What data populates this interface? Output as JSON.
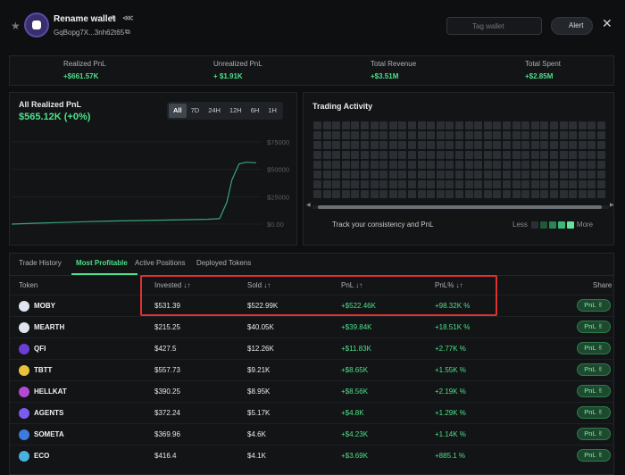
{
  "header": {
    "wallet_name": "Rename wallet",
    "address": "GqBopg7X...3nh62t65",
    "tag_placeholder": "Tag wallet",
    "alert_label": "Alert"
  },
  "stats": [
    {
      "label": "Realized PnL",
      "value": "+$661.57K"
    },
    {
      "label": "Unrealized PnL",
      "value": "+ $1.91K"
    },
    {
      "label": "Total Revenue",
      "value": "+$3.51M"
    },
    {
      "label": "Total Spent",
      "value": "+$2.85M"
    }
  ],
  "pnl_panel": {
    "title": "All Realized PnL",
    "value": "$565.12K (+0%)",
    "ranges": [
      "All",
      "7D",
      "24H",
      "12H",
      "6H",
      "1H"
    ],
    "active_range": "All",
    "yticks": [
      "$75000",
      "$50000",
      "$25000",
      "$0.00"
    ]
  },
  "chart_data": {
    "type": "line",
    "title": "",
    "xlabel": "",
    "ylabel": "",
    "ylim": [
      0,
      75000
    ],
    "x": [
      0,
      10,
      20,
      30,
      40,
      50,
      60,
      70,
      80,
      85,
      88,
      90,
      93,
      96,
      100
    ],
    "series": [
      {
        "values": [
          0,
          800,
          1500,
          2200,
          2800,
          3200,
          3600,
          4000,
          4400,
          5000,
          20000,
          40000,
          55000,
          56500,
          56000
        ]
      }
    ]
  },
  "activity": {
    "title": "Trading Activity",
    "subtitle": "Track your consistency and PnL",
    "legend_less": "Less",
    "legend_more": "More"
  },
  "tabs": [
    "Trade History",
    "Most Profitable",
    "Active Positions",
    "Deployed Tokens"
  ],
  "table": {
    "headers": {
      "token": "Token",
      "invested": "Invested",
      "sold": "Sold",
      "pnl": "PnL",
      "pnl_pct": "PnL%",
      "share": "Share"
    },
    "rows": [
      {
        "token": "MOBY",
        "invested": "$531.39",
        "sold": "$522.99K",
        "pnl": "+$522.46K",
        "pct": "+98.32K %",
        "color": "#dfe6f0"
      },
      {
        "token": "MEARTH",
        "invested": "$215.25",
        "sold": "$40.05K",
        "pnl": "+$39.84K",
        "pct": "+18.51K %",
        "color": "#e0e6ec"
      },
      {
        "token": "QFI",
        "invested": "$427.5",
        "sold": "$12.26K",
        "pnl": "+$11.83K",
        "pct": "+2.77K %",
        "color": "#6b3fd6"
      },
      {
        "token": "TBTT",
        "invested": "$557.73",
        "sold": "$9.21K",
        "pnl": "+$8.65K",
        "pct": "+1.55K %",
        "color": "#e8c23a"
      },
      {
        "token": "HELLKAT",
        "invested": "$390.25",
        "sold": "$8.95K",
        "pnl": "+$8.56K",
        "pct": "+2.19K %",
        "color": "#b24ad6"
      },
      {
        "token": "AGENTS",
        "invested": "$372.24",
        "sold": "$5.17K",
        "pnl": "+$4.8K",
        "pct": "+1.29K %",
        "color": "#7a5cf0"
      },
      {
        "token": "SOMETA",
        "invested": "$369.96",
        "sold": "$4.6K",
        "pnl": "+$4.23K",
        "pct": "+1.14K %",
        "color": "#3d7be0"
      },
      {
        "token": "ECO",
        "invested": "$416.4",
        "sold": "$4.1K",
        "pnl": "+$3.69K",
        "pct": "+885.1 %",
        "color": "#4ab0e0"
      }
    ],
    "share_label": "PnL ✌"
  },
  "colors": {
    "accent": "#4ee08a",
    "highlight": "#e03131"
  }
}
